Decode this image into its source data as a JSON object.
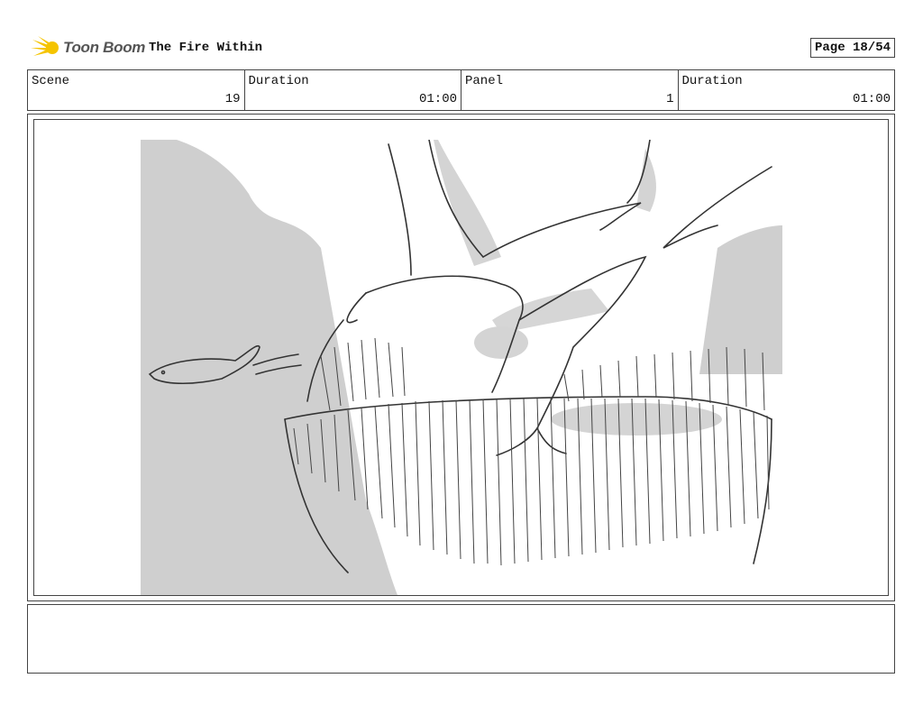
{
  "header": {
    "logo_text": "Toon Boom",
    "title": "The Fire Within",
    "page": "Page 18/54"
  },
  "info": {
    "scene_label": "Scene",
    "scene_value": "19",
    "duration_label": "Duration",
    "duration_value": "01:00",
    "panel_label": "Panel",
    "panel_value": "1",
    "panel_duration_label": "Duration",
    "panel_duration_value": "01:00"
  },
  "notes": {
    "text": ""
  }
}
